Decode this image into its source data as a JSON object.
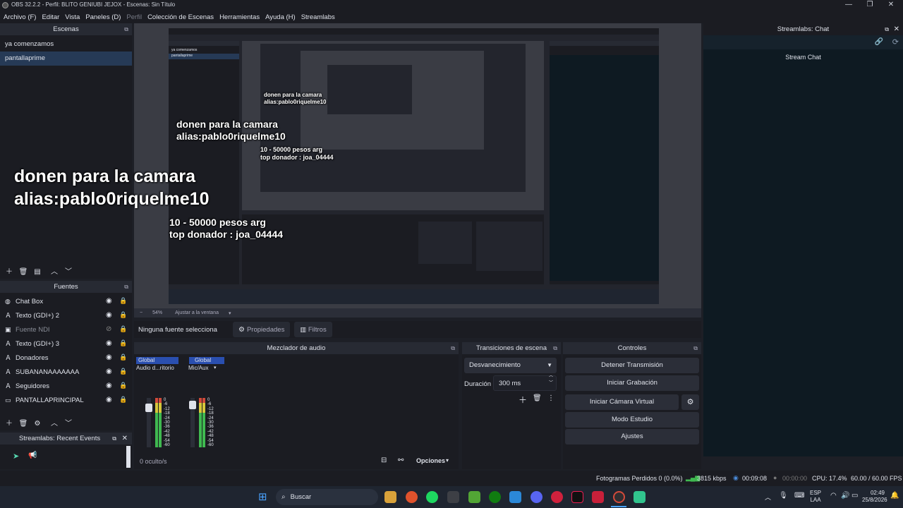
{
  "window": {
    "title": "OBS 32.2.2 - Perfil: BLITO GENIUBI JEJOX - Escenas: Sin Título",
    "min": "—",
    "max": "❐",
    "close": "✕"
  },
  "menu": [
    {
      "label": "Archivo (F)",
      "enabled": true
    },
    {
      "label": "Editar",
      "enabled": true
    },
    {
      "label": "Vista",
      "enabled": true
    },
    {
      "label": "Paneles (D)",
      "enabled": true
    },
    {
      "label": "Perfil",
      "enabled": false
    },
    {
      "label": "Colección de Escenas",
      "enabled": true
    },
    {
      "label": "Herramientas",
      "enabled": true
    },
    {
      "label": "Ayuda (H)",
      "enabled": true
    },
    {
      "label": "Streamlabs",
      "enabled": true
    }
  ],
  "scenes": {
    "title": "Escenas",
    "items": [
      "ya comenzamos",
      "pantallaprime"
    ],
    "selected": 1
  },
  "sources": {
    "title": "Fuentes",
    "items": [
      {
        "label": "Chat Box",
        "icon": "globe-icon",
        "visible": true,
        "locked": true
      },
      {
        "label": "Texto (GDI+) 2",
        "icon": "text-icon",
        "visible": true,
        "locked": true
      },
      {
        "label": "Fuente NDI",
        "icon": "camera-icon",
        "visible": false,
        "locked": true
      },
      {
        "label": "Texto (GDI+) 3",
        "icon": "text-icon",
        "visible": true,
        "locked": true
      },
      {
        "label": "Donadores",
        "icon": "text-icon",
        "visible": true,
        "locked": true
      },
      {
        "label": "SUBANANAAAAAAA",
        "icon": "text-icon",
        "visible": true,
        "locked": true
      },
      {
        "label": "Seguidores",
        "icon": "text-icon",
        "visible": true,
        "locked": true
      },
      {
        "label": "PANTALLAPRINCIPAL",
        "icon": "monitor-icon",
        "visible": true,
        "locked": true
      }
    ]
  },
  "recent_events": {
    "title": "Streamlabs: Recent Events"
  },
  "chat": {
    "title": "Streamlabs: Chat",
    "header": "Stream Chat"
  },
  "preview": {
    "zoom": "54%",
    "fit_label": "Ajustar a la ventana",
    "overlay": {
      "donate_line1": "donen para la camara",
      "donate_line2": "alias:pablo0riquelme10",
      "amount_line": "10 - 50000 pesos arg",
      "top_line": "top donador : joa_04444"
    }
  },
  "properties_bar": {
    "no_source": "Ninguna fuente seleccionac",
    "properties": "Propiedades",
    "filters": "Filtros"
  },
  "mixer": {
    "title": "Mezclador de audio",
    "channels": [
      {
        "tag": "Global",
        "name": "Audio d...ritorio"
      },
      {
        "tag": "Global",
        "name": "Mic/Aux"
      }
    ],
    "scale": [
      "0",
      "-6",
      "-12",
      "-18",
      "-24",
      "-30",
      "-36",
      "-42",
      "-48",
      "-54",
      "-60"
    ],
    "hidden": "0 oculto/s",
    "options": "Opciones"
  },
  "transitions": {
    "title": "Transiciones de escena",
    "selected": "Desvanecimiento",
    "duration_label": "Duración",
    "duration_value": "300 ms"
  },
  "controls": {
    "title": "Controles",
    "buttons": [
      "Detener Transmisión",
      "Iniciar Grabación",
      "Iniciar Cámara Virtual",
      "Modo Estudio",
      "Ajustes"
    ]
  },
  "status": {
    "dropped": "Fotogramas Perdidos 0 (0.0%)",
    "bitrate": "3815 kbps",
    "stream_time": "00:09:08",
    "rec_time": "00:00:00",
    "cpu": "CPU: 17.4%",
    "fps": "60.00 / 60.00 FPS"
  },
  "taskbar": {
    "search": "Buscar",
    "lang_top": "ESP",
    "lang_bottom": "LAA",
    "time": "02:49",
    "date": "25/8/2026"
  },
  "colors": {
    "accent": "#263a56",
    "meter_green": "#3fb950",
    "meter_yellow": "#d6c63a",
    "meter_red": "#d24a3a",
    "global_tag": "#2a4fb0"
  }
}
